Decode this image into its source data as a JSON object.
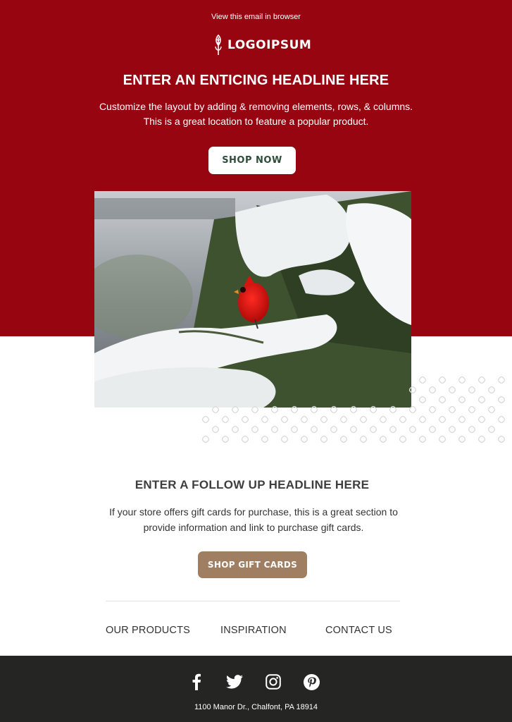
{
  "header": {
    "view_in_browser": "View this email in browser",
    "logo_text": "LOGOIPSUM"
  },
  "hero": {
    "headline": "ENTER AN ENTICING HEADLINE HERE",
    "body": "Customize the layout by adding & removing elements, rows, & columns. This is a great location to feature a popular product.",
    "button_label": "SHOP NOW",
    "image_icon": "cardinal-on-snowy-pine-image"
  },
  "follow_up": {
    "headline": "ENTER A FOLLOW UP HEADLINE HERE",
    "body": "If your store offers gift cards for purchase, this is a great section to provide information and link to purchase gift cards.",
    "button_label": "SHOP GIFT CARDS"
  },
  "nav": {
    "items": [
      {
        "label": "OUR PRODUCTS"
      },
      {
        "label": "INSPIRATION"
      },
      {
        "label": "CONTACT US"
      }
    ]
  },
  "footer": {
    "social": [
      "facebook-icon",
      "twitter-icon",
      "instagram-icon",
      "pinterest-icon"
    ],
    "address": "1100 Manor Dr., Chalfont, PA 18914"
  },
  "colors": {
    "hero_red": "#960510",
    "button_text_green": "#2e4e3a",
    "gift_button": "#a07e62",
    "footer_bg": "#252624"
  }
}
